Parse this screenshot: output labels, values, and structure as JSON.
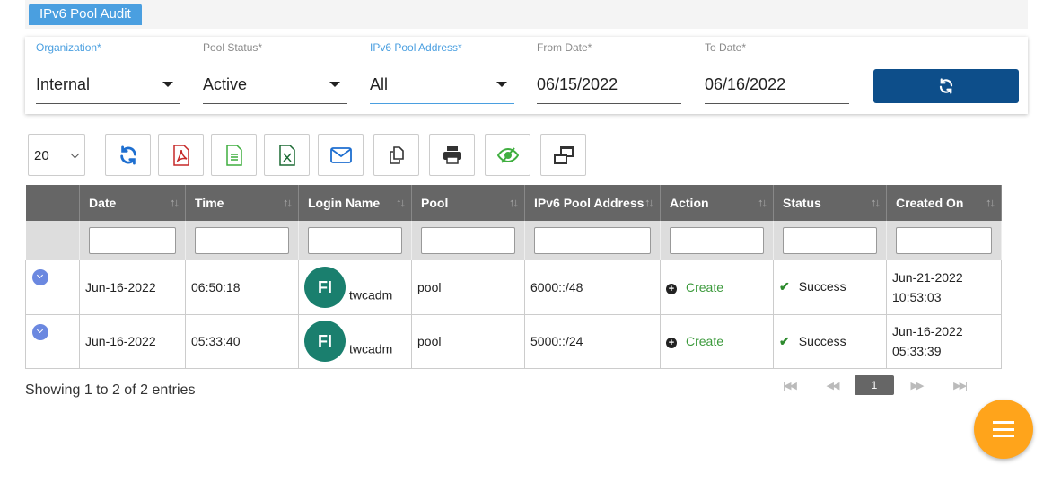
{
  "page_title": "IPv6 Pool Audit",
  "filters": {
    "organization": {
      "label": "Organization*",
      "value": "Internal"
    },
    "pool_status": {
      "label": "Pool Status*",
      "value": "Active"
    },
    "pool_address": {
      "label": "IPv6 Pool Address*",
      "value": "All"
    },
    "from_date": {
      "label": "From Date*",
      "value": "06/15/2022"
    },
    "to_date": {
      "label": "To Date*",
      "value": "06/16/2022"
    }
  },
  "toolbar": {
    "page_size": "20",
    "buttons": [
      "refresh-icon",
      "pdf-icon",
      "csv-icon",
      "excel-icon",
      "mail-icon",
      "copy-icon",
      "print-icon",
      "column-visibility-icon",
      "restore-icon"
    ]
  },
  "table": {
    "columns": [
      "Date",
      "Time",
      "Login Name",
      "Pool",
      "IPv6 Pool Address",
      "Action",
      "Status",
      "Created On"
    ],
    "rows": [
      {
        "date": "Jun-16-2022",
        "time": "06:50:18",
        "avatar": "FI",
        "login": "twcadm",
        "pool": "pool",
        "address": "6000::/48",
        "action": "Create",
        "status": "Success",
        "created_date": "Jun-21-2022",
        "created_time": "10:53:03"
      },
      {
        "date": "Jun-16-2022",
        "time": "05:33:40",
        "avatar": "FI",
        "login": "twcadm",
        "pool": "pool",
        "address": "5000::/24",
        "action": "Create",
        "status": "Success",
        "created_date": "Jun-16-2022",
        "created_time": "05:33:39"
      }
    ]
  },
  "footer": {
    "info": "Showing 1 to 2 of 2 entries",
    "current_page": "1"
  },
  "colors": {
    "primary": "#0d4e8a",
    "accent": "#4a9fe0",
    "avatar": "#1a7f6e",
    "fab": "#ffa41b",
    "success": "#3c9a3c"
  }
}
